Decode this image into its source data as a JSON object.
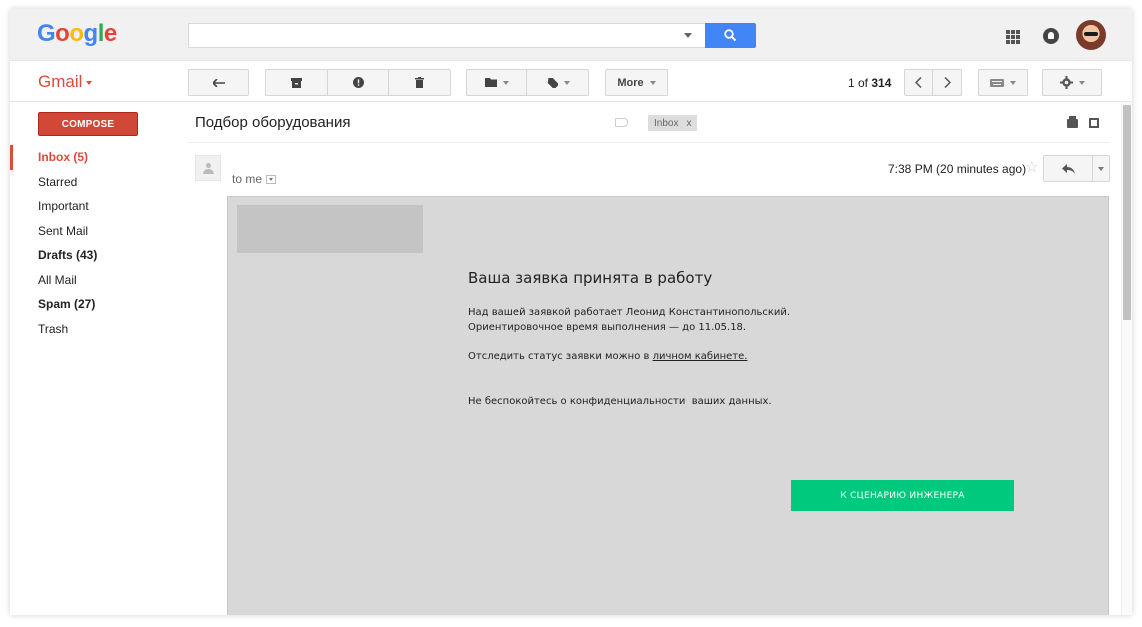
{
  "header": {
    "logo_text": "Google",
    "search": {
      "value": "",
      "placeholder": ""
    }
  },
  "toolbar": {
    "app_label": "Gmail",
    "more_label": "More",
    "pager_prefix": "1 of",
    "pager_total": "314"
  },
  "sidebar": {
    "compose_label": "COMPOSE",
    "items": [
      {
        "label": "Inbox (5)"
      },
      {
        "label": "Starred"
      },
      {
        "label": "Important"
      },
      {
        "label": "Sent Mail"
      },
      {
        "label": "Drafts (43)"
      },
      {
        "label": "All Mail"
      },
      {
        "label": "Spam (27)"
      },
      {
        "label": "Trash"
      }
    ]
  },
  "message": {
    "subject": "Подбор оборудования",
    "label_chip": "Inbox",
    "label_chip_remove": "x",
    "recipient": "to me",
    "timestamp": "7:38 PM (20 minutes ago)"
  },
  "email": {
    "title": "Ваша заявка принята в работу",
    "line1": "Над вашей заявкой работает Леонид Константинопольский.",
    "line2": "Ориентировочное время выполнения — до 11.05.18.",
    "status_prefix": "Отследить статус заявки можно в ",
    "status_link": "личном кабинете.",
    "privacy": "Не беспокойтесь о конфиденциальности  ваших данных.",
    "cta_label": "К СЦЕНАРИЮ ИНЖЕНЕРА"
  },
  "colors": {
    "gmail_red": "#dd4b39",
    "compose_red": "#d14836",
    "search_blue": "#4285f4",
    "cta_green": "#00c97d",
    "email_bg": "#d8d8d8"
  },
  "icons": {
    "search": "search-icon",
    "apps": "apps-grid-icon",
    "notifications": "notifications-icon",
    "back": "back-arrow-icon",
    "archive": "archive-icon",
    "spam": "report-spam-icon",
    "delete": "trash-icon",
    "move": "folder-icon",
    "labels": "label-icon",
    "prev": "chevron-left-icon",
    "next": "chevron-right-icon",
    "input_tools": "keyboard-icon",
    "settings": "gear-icon",
    "print": "print-icon",
    "new_window": "new-window-icon",
    "star": "star-icon",
    "reply": "reply-icon"
  }
}
